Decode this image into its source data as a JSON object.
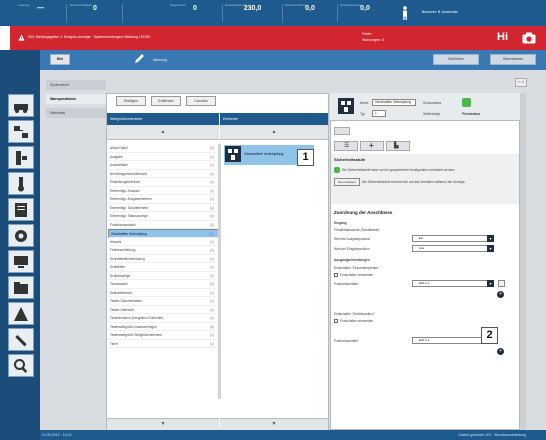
{
  "topbar": {
    "cells": [
      {
        "label": "Leistung",
        "value": "—"
      },
      {
        "label": "Geschwindigkeit",
        "value": "0"
      },
      {
        "label": "Wegstrecke",
        "value": "0"
      },
      {
        "label": "Hauptspannung",
        "value": "230,0"
      },
      {
        "label": "Stromaufnahme",
        "value": "0,0"
      },
      {
        "label": "Gesamtleistung",
        "value": "0,0"
      }
    ],
    "user": "Benutzer: B. Anwender"
  },
  "alarm": {
    "title": "003: Stellungsgeber 1: Ereignis-Anzeige · Systemmeldungen: Meldung 102451",
    "right_line1": "Fehler",
    "right_line2": "Warnungen: 0",
    "logo": "Hi"
  },
  "toolbar": {
    "edit_label": "Bild",
    "title": "Warnung",
    "btn_right1": "Schließen",
    "btn_right2": "Übernehmen"
  },
  "nav": {
    "items": [
      "Systemsicht",
      "Warnpositionen",
      "Hilfsmittel"
    ],
    "active": 1
  },
  "middle": {
    "buttons": [
      "Einfügen",
      "Entfernen",
      "Löschen"
    ],
    "col1_header": "Stellgrößenelemente",
    "col2_header": "Elemente",
    "list": [
      {
        "label": "Aktuell Wahl",
        "count": "(1)"
      },
      {
        "label": "Ausgabe",
        "count": "(1)"
      },
      {
        "label": "Auswahlliste",
        "count": "(1)"
      },
      {
        "label": "Bereichsgrenzenübersicht",
        "count": "(1)"
      },
      {
        "label": "Einstellungsübersicht",
        "count": "(1)"
      },
      {
        "label": "Elementtyp: Auswahl",
        "count": "(1)"
      },
      {
        "label": "Elementtyp: Ausgabeelement",
        "count": "(1)"
      },
      {
        "label": "Elementtyp: Schaltelement",
        "count": "(1)"
      },
      {
        "label": "Elementtyp: Statusanzeige",
        "count": "(2)"
      },
      {
        "label": "Funktionsauswahl",
        "count": "(1)"
      },
      {
        "label": "Geschaltete Verknüpfung",
        "count": "(1)"
      },
      {
        "label": "Hinweis",
        "count": "(1)"
      },
      {
        "label": "Feldbeschreibung",
        "count": "(1)"
      },
      {
        "label": "Schnittstellenverbindung",
        "count": "(1)"
      },
      {
        "label": "Schrittliste",
        "count": "(1)"
      },
      {
        "label": "Schrittanzeige",
        "count": "(1)"
      },
      {
        "label": "Textauswahl",
        "count": "(1)"
      },
      {
        "label": "Statusübersicht",
        "count": "(1)"
      },
      {
        "label": "Tasten-Dokumentation",
        "count": "(1)"
      },
      {
        "label": "Tasten-Übersicht",
        "count": "(1)"
      },
      {
        "label": "Tastenfunktion (Integration Controller)",
        "count": "(1)"
      },
      {
        "label": "Tastenstellgröße Instanzenfolgen",
        "count": "(4)"
      },
      {
        "label": "Tastenstellgröße Stellgrößenelement",
        "count": "(1)"
      },
      {
        "label": "Timer",
        "count": "(1)"
      }
    ],
    "selected_index": 10,
    "selected_element": "Geschaltete Verknüpfung",
    "callout1": "1"
  },
  "right": {
    "name_label": "Name",
    "name_value": "Geschaltete Verknüpfung",
    "type_label": "Typ",
    "type_value": "1",
    "schutzstatus_label": "Schutzstatus",
    "stellkreis_label": "Stellkreistyp",
    "stellkreis_value": "Privatstatus",
    "section1": "Sicherheitsstufe",
    "info_text": "Die Sicherheitsstufe kann nur bei gespeicherter Konfiguration verändert werden.",
    "erfassen_label": "Neu erfassen",
    "info_text2": "Die Sicherheitsstufe bezieht sich auf das Verhalten während der Anzeige.",
    "section2": "Zuordnung der Anschlüsse",
    "sub_eingang": "Eingang",
    "sub_prim": "Primärstatuswerte (Schaltwerte)",
    "row_a": "Wert auf Ausgabeposition",
    "row_a_val": "Ein",
    "row_b": "Wert auf Eingabeposition",
    "row_b_val": "Aus",
    "sub_ausgang": "Ausgangseinstellungen",
    "sub_a": "Endschalter \"Einbautemperatur\"",
    "chk_a": "Endschalter verwenden",
    "row_c": "Positionsschalter",
    "row_c_val": "E20.1.1",
    "sub_b": "Endschalter \"Geräteposition\"",
    "chk_b": "Endschalter verwenden",
    "row_d": "Positionsschalter",
    "row_d_val": "E20.1.2",
    "callout2": "2"
  },
  "statusbar": {
    "left": "21.06.2012 · 14:23",
    "right": "Zuletzt geändert: 001 · Benutzeranmeldung"
  }
}
